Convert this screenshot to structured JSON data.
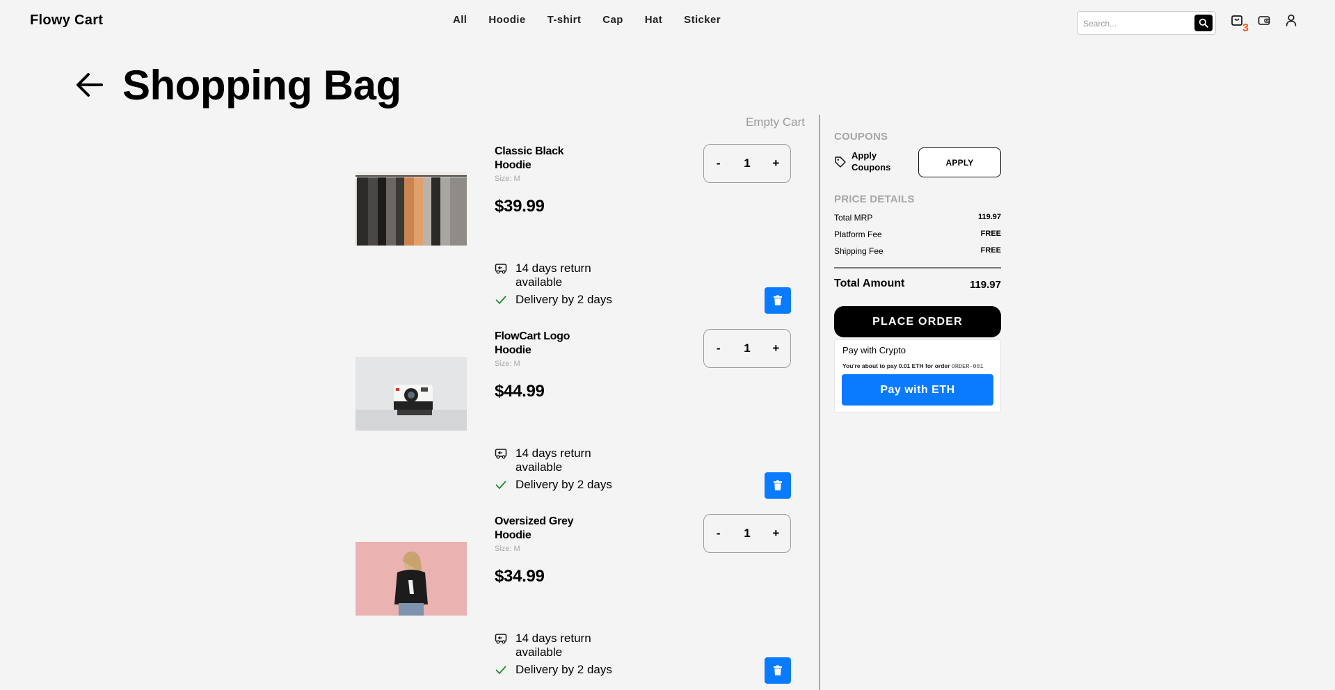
{
  "header": {
    "brand": "Flowy Cart",
    "nav": [
      "All",
      "Hoodie",
      "T-shirt",
      "Cap",
      "Hat",
      "Sticker"
    ],
    "search_placeholder": "Search...",
    "cart_count": "3",
    "icons": [
      "search-icon",
      "cart-icon",
      "wallet-icon",
      "user-icon"
    ]
  },
  "page": {
    "title": "Shopping Bag",
    "empty_cart_label": "Empty Cart"
  },
  "cart": {
    "items": [
      {
        "name": "Classic Black Hoodie",
        "size": "Size: M",
        "price": "$39.99",
        "qty": "1",
        "return_text": "14 days return available",
        "delivery_text": "Delivery by 2 days",
        "image": "clothes-rack-photo"
      },
      {
        "name": "FlowCart Logo Hoodie",
        "size": "Size: M",
        "price": "$44.99",
        "qty": "1",
        "return_text": "14 days return available",
        "delivery_text": "Delivery by 2 days",
        "image": "instant-camera-photo"
      },
      {
        "name": "Oversized Grey Hoodie",
        "size": "Size: M",
        "price": "$34.99",
        "qty": "1",
        "return_text": "14 days return available",
        "delivery_text": "Delivery by 2 days",
        "image": "person-pink-wall-photo"
      }
    ],
    "minus_label": "-",
    "plus_label": "+"
  },
  "summary": {
    "coupons_heading": "COUPONS",
    "apply_coupons_label": "Apply Coupons",
    "apply_button": "APPLY",
    "price_details_heading": "PRICE DETAILS",
    "rows": [
      {
        "label": "Total MRP",
        "value": "119.97"
      },
      {
        "label": "Platform Fee",
        "value": "FREE"
      },
      {
        "label": "Shipping Fee",
        "value": "FREE"
      }
    ],
    "total_label": "Total Amount",
    "total_value": "119.97",
    "place_order": "PLACE ORDER",
    "crypto": {
      "title": "Pay with Crypto",
      "message_prefix": "You're about to pay 0.01 ETH for order",
      "order_id": "ORDER-001",
      "button": "Pay with ETH"
    }
  },
  "colors": {
    "accent_blue": "#0a7bff",
    "badge_orange": "#f05a1a",
    "background": "#f4f4f4"
  }
}
